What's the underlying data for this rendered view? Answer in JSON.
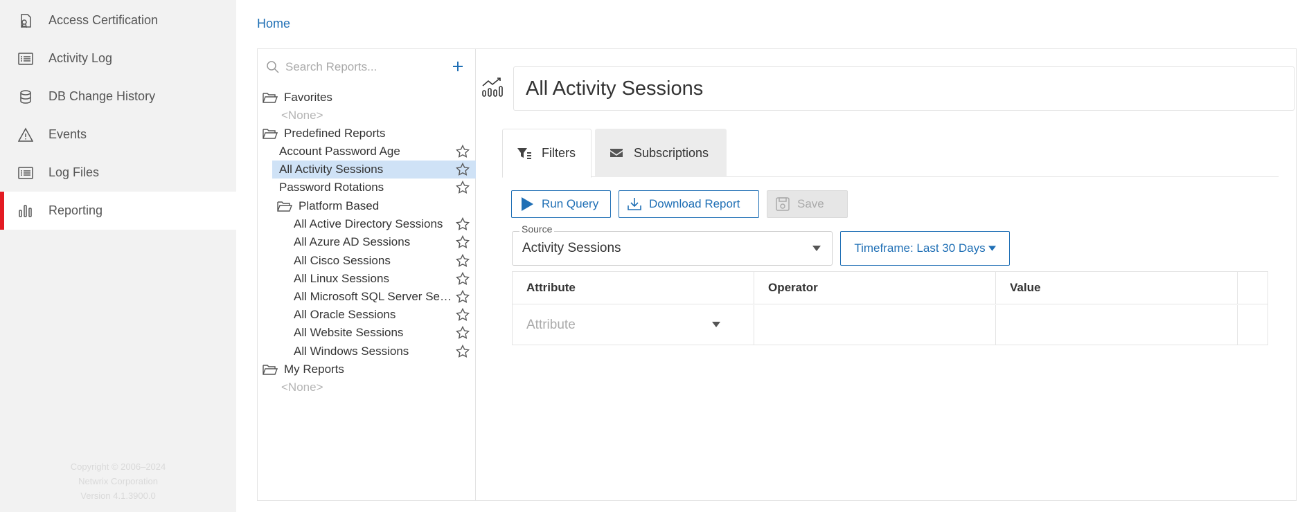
{
  "nav": {
    "items": [
      {
        "label": "Access Certification",
        "icon": "certificate-icon"
      },
      {
        "label": "Activity Log",
        "icon": "list-icon"
      },
      {
        "label": "DB Change History",
        "icon": "database-icon"
      },
      {
        "label": "Events",
        "icon": "warning-icon"
      },
      {
        "label": "Log Files",
        "icon": "list-icon"
      },
      {
        "label": "Reporting",
        "icon": "bar-chart-icon",
        "active": true
      }
    ],
    "copyright": [
      "Copyright © 2006–2024",
      "Netwrix Corporation",
      "Version 4.1.3900.0"
    ]
  },
  "breadcrumb": {
    "home": "Home"
  },
  "tree": {
    "search_placeholder": "Search Reports...",
    "favorites": {
      "label": "Favorites",
      "empty": "<None>"
    },
    "predefined": {
      "label": "Predefined Reports",
      "reports": [
        "Account Password Age",
        "All Activity Sessions",
        "Password Rotations"
      ],
      "selected": "All Activity Sessions",
      "platform": {
        "label": "Platform Based",
        "reports": [
          "All Active Directory Sessions",
          "All Azure AD Sessions",
          "All Cisco Sessions",
          "All Linux Sessions",
          "All Microsoft SQL Server Sessions",
          "All Oracle Sessions",
          "All Website Sessions",
          "All Windows Sessions"
        ]
      }
    },
    "my_reports": {
      "label": "My Reports",
      "empty": "<None>"
    }
  },
  "report": {
    "title": "All Activity Sessions",
    "tabs": {
      "filters": "Filters",
      "subscriptions": "Subscriptions"
    },
    "buttons": {
      "run": "Run Query",
      "download": "Download Report",
      "save": "Save"
    },
    "source": {
      "label": "Source",
      "value": "Activity Sessions"
    },
    "timeframe": "Timeframe: Last 30 Days",
    "grid": {
      "headers": [
        "Attribute",
        "Operator",
        "Value"
      ],
      "attribute_placeholder": "Attribute"
    }
  },
  "colors": {
    "accent": "#1f6fb5",
    "active_marker": "#e31b23",
    "selected_row": "#cfe2f6"
  }
}
